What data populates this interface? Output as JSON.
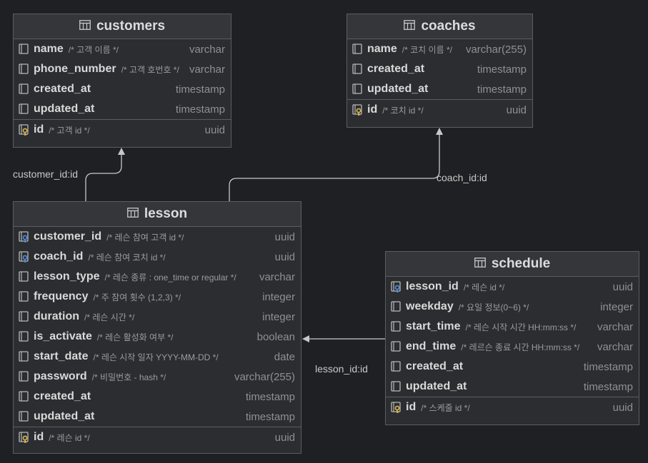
{
  "tables": {
    "customers": {
      "name": "customers",
      "columns": [
        {
          "name": "name",
          "comment": "/* 고객 이름 */",
          "type": "varchar"
        },
        {
          "name": "phone_number",
          "comment": "/* 고객 호번호 */",
          "type": "varchar"
        },
        {
          "name": "created_at",
          "comment": "",
          "type": "timestamp"
        },
        {
          "name": "updated_at",
          "comment": "",
          "type": "timestamp"
        }
      ],
      "pk": {
        "name": "id",
        "comment": "/* 고객 id */",
        "type": "uuid"
      }
    },
    "coaches": {
      "name": "coaches",
      "columns": [
        {
          "name": "name",
          "comment": "/* 코치 이름 */",
          "type": "varchar(255)"
        },
        {
          "name": "created_at",
          "comment": "",
          "type": "timestamp"
        },
        {
          "name": "updated_at",
          "comment": "",
          "type": "timestamp"
        }
      ],
      "pk": {
        "name": "id",
        "comment": "/* 코치 id */",
        "type": "uuid"
      }
    },
    "lesson": {
      "name": "lesson",
      "columns": [
        {
          "name": "customer_id",
          "comment": "/* 레슨 참여 고객 id */",
          "type": "uuid"
        },
        {
          "name": "coach_id",
          "comment": "/* 레슨 참여 코치 id */",
          "type": "uuid"
        },
        {
          "name": "lesson_type",
          "comment": "/* 레슨 종류 : one_time  or regular */",
          "type": "varchar"
        },
        {
          "name": "frequency",
          "comment": "/* 주 참여 횟수 (1,2,3) */",
          "type": "integer"
        },
        {
          "name": "duration",
          "comment": "/* 레슨 시간 */",
          "type": "integer"
        },
        {
          "name": "is_activate",
          "comment": "/* 레슨 활성화 여부 */",
          "type": "boolean"
        },
        {
          "name": "start_date",
          "comment": "/* 레슨 시작 일자 YYYY-MM-DD */",
          "type": "date"
        },
        {
          "name": "password",
          "comment": "/* 비밀번호 - hash */",
          "type": "varchar(255)"
        },
        {
          "name": "created_at",
          "comment": "",
          "type": "timestamp"
        },
        {
          "name": "updated_at",
          "comment": "",
          "type": "timestamp"
        }
      ],
      "pk": {
        "name": "id",
        "comment": "/* 레슨 id */",
        "type": "uuid"
      }
    },
    "schedule": {
      "name": "schedule",
      "columns": [
        {
          "name": "lesson_id",
          "comment": "/* 레슨 id */",
          "type": "uuid"
        },
        {
          "name": "weekday",
          "comment": "/* 요일 정보(0~6) */",
          "type": "integer"
        },
        {
          "name": "start_time",
          "comment": "/* 레슨 시작 시간 HH:mm:ss */",
          "type": "varchar"
        },
        {
          "name": "end_time",
          "comment": "/* 레르슨 종료 시간 HH:mm:ss */",
          "type": "varchar"
        },
        {
          "name": "created_at",
          "comment": "",
          "type": "timestamp"
        },
        {
          "name": "updated_at",
          "comment": "",
          "type": "timestamp"
        }
      ],
      "pk": {
        "name": "id",
        "comment": "/* 스케줄 id */",
        "type": "uuid"
      }
    }
  },
  "relations": {
    "customer": "customer_id:id",
    "coach": "coach_id:id",
    "lesson": "lesson_id:id"
  },
  "colors": {
    "background": "#1f2023",
    "table_bg": "#2b2d30",
    "header_bg": "#34363a",
    "border": "#5a5d63",
    "fk_key": "#4f8fe0",
    "pk_key": "#e0b84a"
  }
}
